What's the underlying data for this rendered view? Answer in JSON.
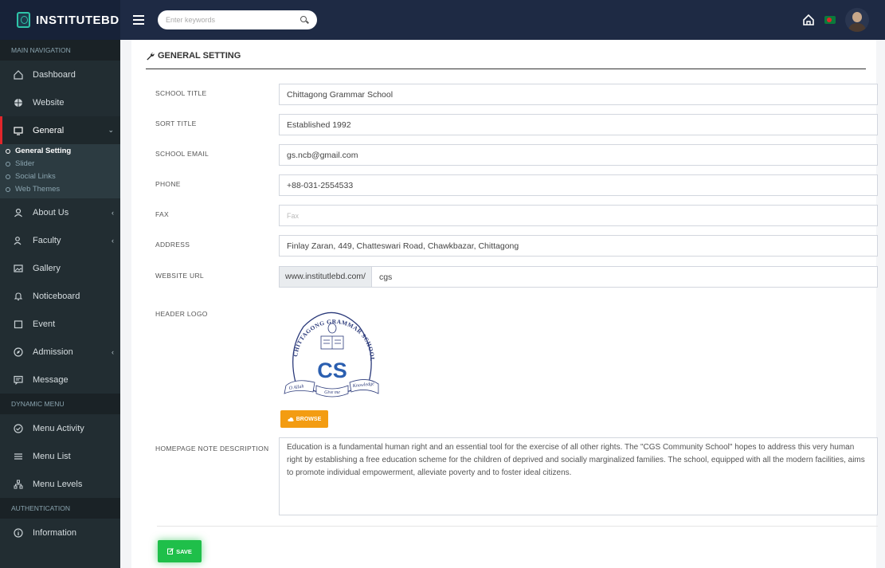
{
  "app": {
    "brand": "INSTITUTEBD"
  },
  "topbar": {
    "search_placeholder": "Enter keywords"
  },
  "sidebar": {
    "headers": {
      "main": "MAIN NAVIGATION",
      "dynamic": "DYNAMIC MENU",
      "auth": "AUTHENTICATION"
    },
    "items": {
      "dashboard": "Dashboard",
      "website": "Website",
      "general": "General",
      "about_us": "About Us",
      "faculty": "Faculty",
      "gallery": "Gallery",
      "noticeboard": "Noticeboard",
      "event": "Event",
      "admission": "Admission",
      "message": "Message",
      "menu_activity": "Menu Activity",
      "menu_list": "Menu List",
      "menu_levels": "Menu Levels",
      "information": "Information"
    },
    "general_sub": [
      "General Setting",
      "Slider",
      "Social Links",
      "Web Themes"
    ],
    "active_accent": "#e0262b"
  },
  "form": {
    "title": "GENERAL SETTING",
    "labels": {
      "school_title": "SCHOOL TITLE",
      "sort_title": "SORT TITLE",
      "school_email": "SCHOOL EMAIL",
      "phone": "PHONE",
      "fax": "FAX",
      "address": "ADDRESS",
      "website_url": "WEBSITE URL",
      "header_logo": "HEADER LOGO",
      "homepage_note": "HOMEPAGE NOTE DESCRIPTION"
    },
    "values": {
      "school_title": "Chittagong Grammar School",
      "sort_title": "Established 1992",
      "school_email": "gs.ncb@gmail.com",
      "phone": "+88-031-2554533",
      "fax": "",
      "address": "Finlay Zaran, 449, Chatteswari Road, Chawkbazar, Chittagong",
      "website_url_prefix": "www.institutlebd.com/",
      "website_url_slug": "cgs",
      "homepage_note": "Education is a fundamental human right and an essential tool for the exercise of all other rights. The \"CGS Community School\" hopes to address this very human right by establishing a free education scheme for the children of deprived and socially marginalized families. The school, equipped with all the modern facilities, aims to promote individual empowerment, alleviate poverty and to foster ideal citizens."
    },
    "placeholders": {
      "fax": "Fax"
    },
    "logo": {
      "arc_text": "CHITTAGONG GRAMMAR SCHOOL",
      "initials": "CS",
      "motto_left": "O Allah",
      "motto_right": "Knowledge",
      "motto_bottom": "Give me"
    },
    "browse_label": "BROWSE",
    "save_label": "SAVE",
    "colors": {
      "browse": "#f39c12",
      "save": "#1fbf4a",
      "topbar": "#1e2a44",
      "sidebar": "#222d32"
    }
  }
}
